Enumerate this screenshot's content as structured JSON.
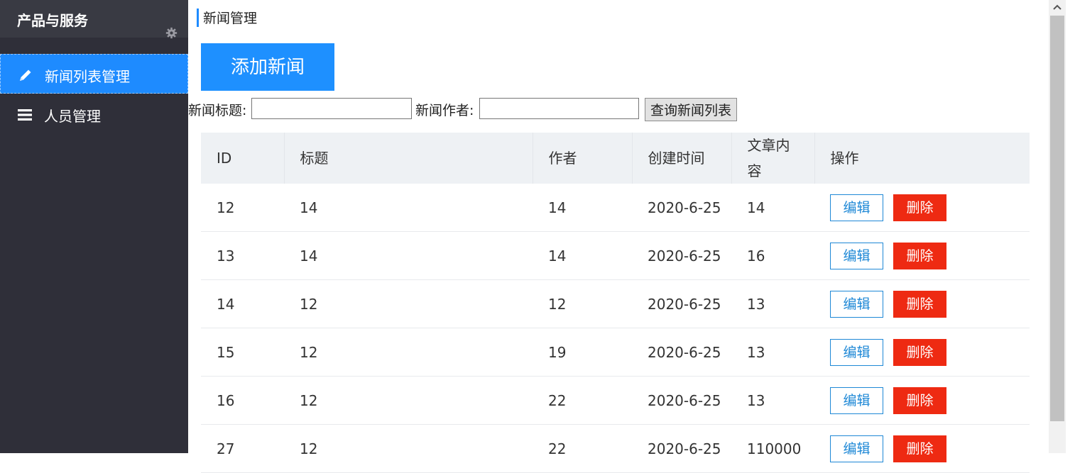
{
  "sidebar": {
    "title": "产品与服务",
    "items": [
      {
        "label": "新闻列表管理",
        "icon": "pencil-icon",
        "active": true
      },
      {
        "label": "人员管理",
        "icon": "menu-icon",
        "active": false
      }
    ]
  },
  "main": {
    "page_title": "新闻管理",
    "add_button": "添加新闻",
    "search": {
      "title_label": "新闻标题:",
      "title_value": "",
      "author_label": "新闻作者:",
      "author_value": "",
      "query_button": "查询新闻列表"
    },
    "table": {
      "columns": [
        "ID",
        "标题",
        "作者",
        "创建时间",
        "文章内容",
        "操作"
      ],
      "edit_label": "编辑",
      "delete_label": "删除",
      "rows": [
        {
          "id": "12",
          "title": "14",
          "author": "14",
          "created": "2020-6-25",
          "content": "14"
        },
        {
          "id": "13",
          "title": "14",
          "author": "14",
          "created": "2020-6-25",
          "content": "16"
        },
        {
          "id": "14",
          "title": "12",
          "author": "12",
          "created": "2020-6-25",
          "content": "13"
        },
        {
          "id": "15",
          "title": "12",
          "author": "19",
          "created": "2020-6-25",
          "content": "13"
        },
        {
          "id": "16",
          "title": "12",
          "author": "22",
          "created": "2020-6-25",
          "content": "13"
        },
        {
          "id": "27",
          "title": "12",
          "author": "22",
          "created": "2020-6-25",
          "content": "110000"
        }
      ]
    }
  },
  "colors": {
    "sidebar_bg": "#2f2f39",
    "accent": "#1e8bff",
    "delete": "#ee2a12",
    "header_bg": "#eef1f4"
  }
}
